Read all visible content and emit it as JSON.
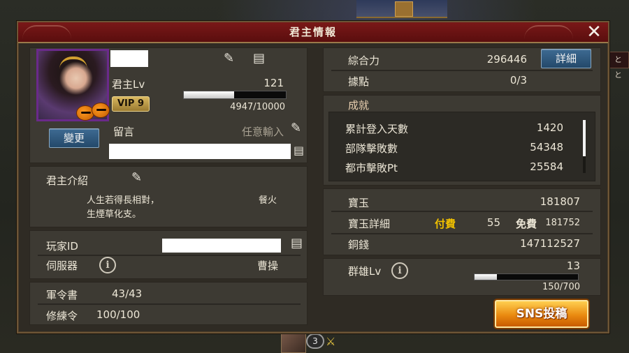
{
  "background": {
    "right_tab": "とと",
    "bottom_badge": "3"
  },
  "dialog": {
    "title": "君主情報",
    "close": "✕"
  },
  "profile": {
    "lord_level_label": "君主Lv",
    "lord_level": "121",
    "vip": "VIP 9",
    "exp_text": "4947/10000",
    "exp_fraction": 0.4947,
    "change_button": "變更",
    "message_label": "留言",
    "message_placeholder": "任意輸入"
  },
  "intro": {
    "label": "君主介紹",
    "line1": "人生若得長相對，",
    "line1_right": "餐火",
    "line2": "生煙草化支。"
  },
  "player": {
    "id_label": "玩家ID",
    "server_label": "伺服器",
    "server_value": "曹操"
  },
  "orders": {
    "army_label": "軍令書",
    "army_value": "43/43",
    "train_label": "修練令",
    "train_value": "100/100"
  },
  "power": {
    "label": "綜合力",
    "value": "296446",
    "details_button": "詳細",
    "base_label": "據點",
    "base_value": "0/3"
  },
  "achievements": {
    "label": "成就",
    "rows": [
      {
        "label": "累計登入天數",
        "value": "1420"
      },
      {
        "label": "部隊擊敗數",
        "value": "54348"
      },
      {
        "label": "都市擊敗Pt",
        "value": "25584"
      }
    ],
    "scroll_fraction": 0.28
  },
  "currency": {
    "gem_label": "寶玉",
    "gem_value": "181807",
    "gem_detail_label": "寶玉詳細",
    "paid_label": "付費",
    "paid_value": "55",
    "free_label": "免費",
    "free_value": "181752",
    "copper_label": "銅錢",
    "copper_value": "147112527"
  },
  "hero": {
    "label": "群雄Lv",
    "level": "13",
    "exp_text": "150/700",
    "exp_fraction": 0.214
  },
  "sns_button": "SNS投稿"
}
